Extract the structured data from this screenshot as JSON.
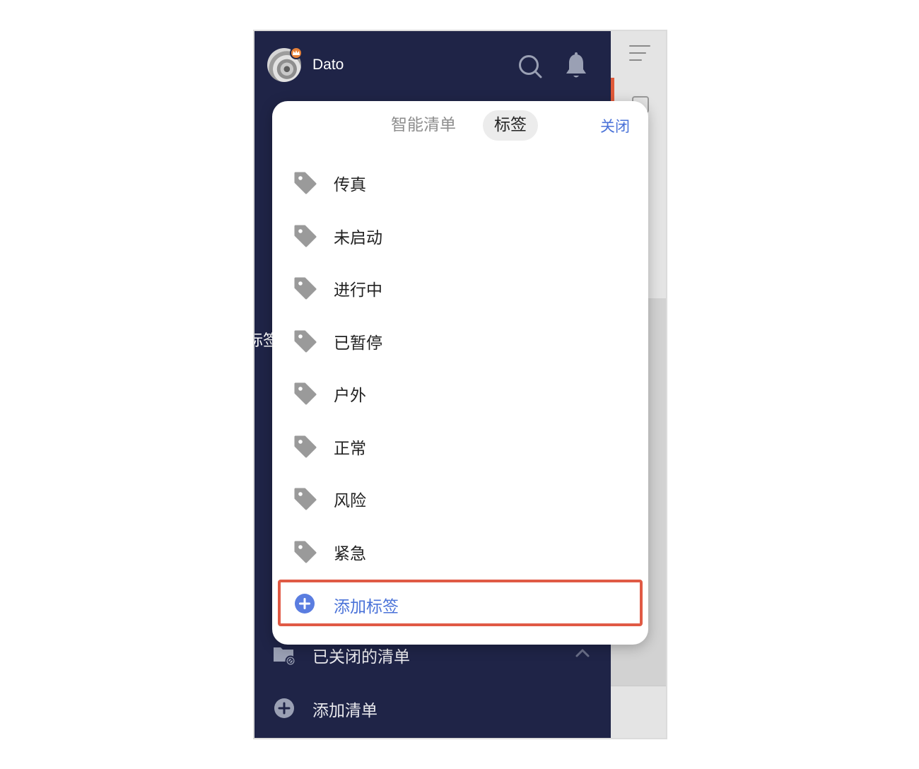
{
  "header": {
    "username": "Dato"
  },
  "sidebar": {
    "partial_label": "标签",
    "bottom_items": [
      {
        "label": "已关闭的清单",
        "icon": "folder-closed-icon"
      },
      {
        "label": "添加清单",
        "icon": "plus-circle-icon"
      }
    ]
  },
  "popup": {
    "tabs": [
      {
        "label": "智能清单",
        "active": false
      },
      {
        "label": "标签",
        "active": true
      }
    ],
    "close_label": "关闭",
    "tags": [
      {
        "label": "传真"
      },
      {
        "label": "未启动"
      },
      {
        "label": "进行中"
      },
      {
        "label": "已暂停"
      },
      {
        "label": "户外"
      },
      {
        "label": "正常"
      },
      {
        "label": "风险"
      },
      {
        "label": "紧急"
      }
    ],
    "add_tag_label": "添加标签"
  },
  "colors": {
    "sidebar_bg": "#1f2447",
    "accent_blue": "#4a72d8",
    "highlight_red": "#e05a45",
    "tag_icon_gray": "#9a9a9a"
  }
}
